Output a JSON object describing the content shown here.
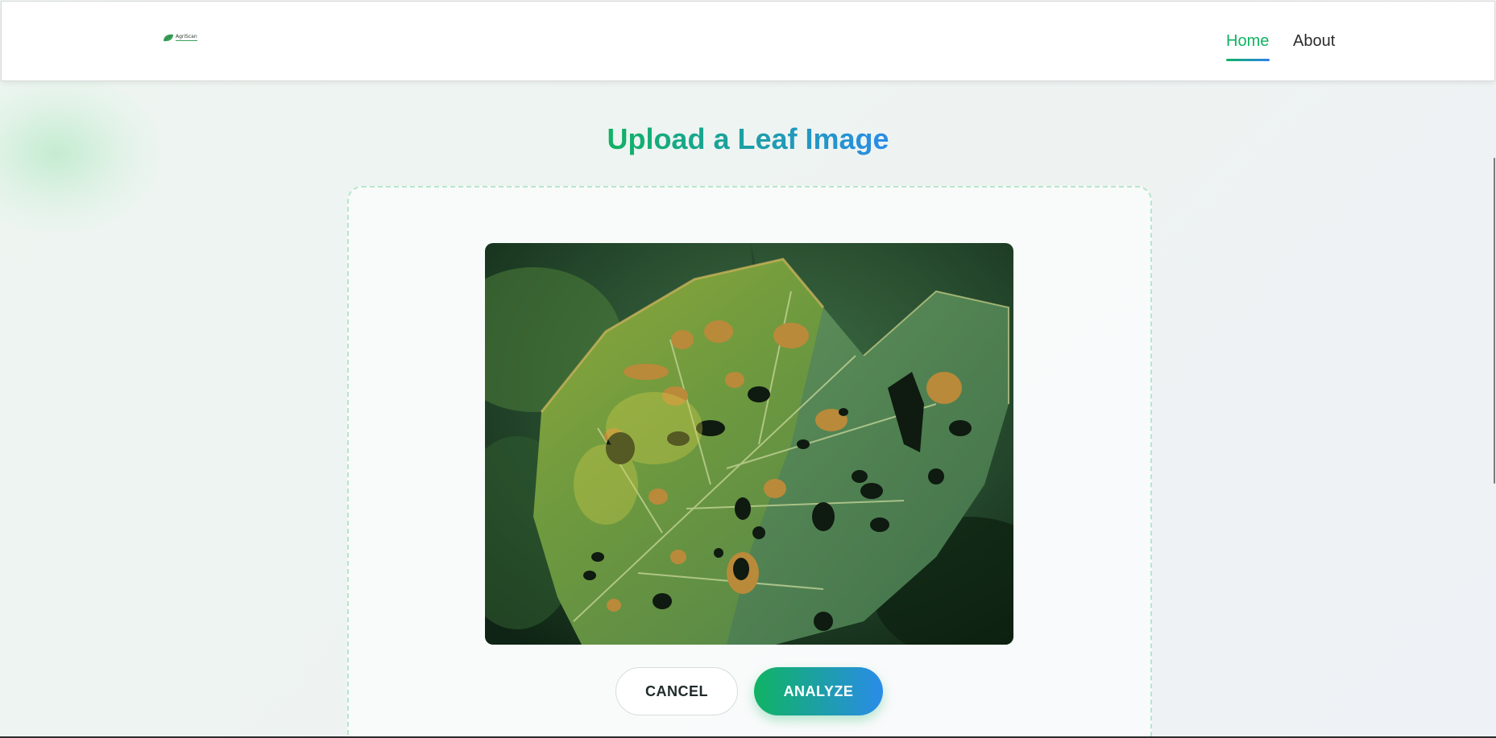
{
  "brand": {
    "logo_text": "AgriScan",
    "logo_icon": "leaf-icon"
  },
  "nav": {
    "home_label": "Home",
    "about_label": "About",
    "active": "Home"
  },
  "main": {
    "title": "Upload a Leaf Image",
    "preview_alt": "uploaded-leaf-image",
    "cancel_label": "CANCEL",
    "analyze_label": "ANALYZE"
  },
  "colors": {
    "accent_green": "#10b363",
    "accent_blue": "#2a8ce8",
    "dashed_border": "#b6e6cc"
  }
}
